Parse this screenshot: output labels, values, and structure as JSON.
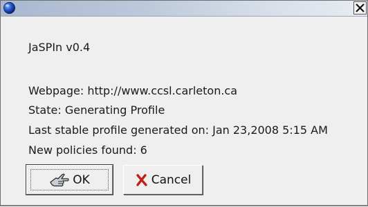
{
  "window": {
    "title": ""
  },
  "dialog": {
    "app_name": "JaSPIn v0.4",
    "webpage": "Webpage: http://www.ccsl.carleton.ca",
    "state": "State: Generating Profile",
    "last_profile": "Last stable profile generated on:  Jan 23,2008 5:15 AM",
    "policies": "New policies found: 6"
  },
  "buttons": {
    "ok_label": "OK",
    "cancel_label": "Cancel"
  },
  "icons": {
    "title_icon": "globe-icon",
    "close": "close-icon",
    "ok": "hand-pointer-icon",
    "cancel": "red-x-icon"
  },
  "colors": {
    "titlebar": "#a9b8cf",
    "background": "#efefef",
    "cancel_x": "#c0201a"
  }
}
